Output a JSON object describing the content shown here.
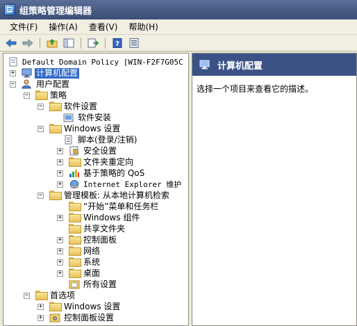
{
  "window": {
    "title": "组策略管理编辑器"
  },
  "menu": [
    "文件(F)",
    "操作(A)",
    "查看(V)",
    "帮助(H)"
  ],
  "toolbar": [
    "back-icon",
    "forward-icon",
    "up-folder-icon",
    "show-hide-tree-icon",
    "export-list-icon",
    "help-icon",
    "properties-icon"
  ],
  "tree": {
    "root": "Default Domain Policy [WIN-F2F7G05C",
    "computer_config": "计算机配置",
    "user_config": "用户配置",
    "policies": "策略",
    "software_settings": "软件设置",
    "software_install": "软件安装",
    "windows_settings": "Windows 设置",
    "scripts": "脚本(登录/注销)",
    "security_settings": "安全设置",
    "folder_redirection": "文件夹重定向",
    "qos": "基于策略的 QoS",
    "ie_maintenance": "Internet Explorer 维护",
    "admin_templates": "管理模板: 从本地计算机检索",
    "start_menu": "“开始”菜单和任务栏",
    "windows_components": "Windows 组件",
    "shared_folders": "共享文件夹",
    "control_panel": "控制面板",
    "network": "网络",
    "system": "系统",
    "desktop": "桌面",
    "all_settings": "所有设置",
    "preferences": "首选项",
    "pref_windows_settings": "Windows 设置",
    "pref_control_panel": "控制面板设置"
  },
  "right": {
    "header": "计算机配置",
    "description": "选择一个项目来查看它的描述。"
  }
}
